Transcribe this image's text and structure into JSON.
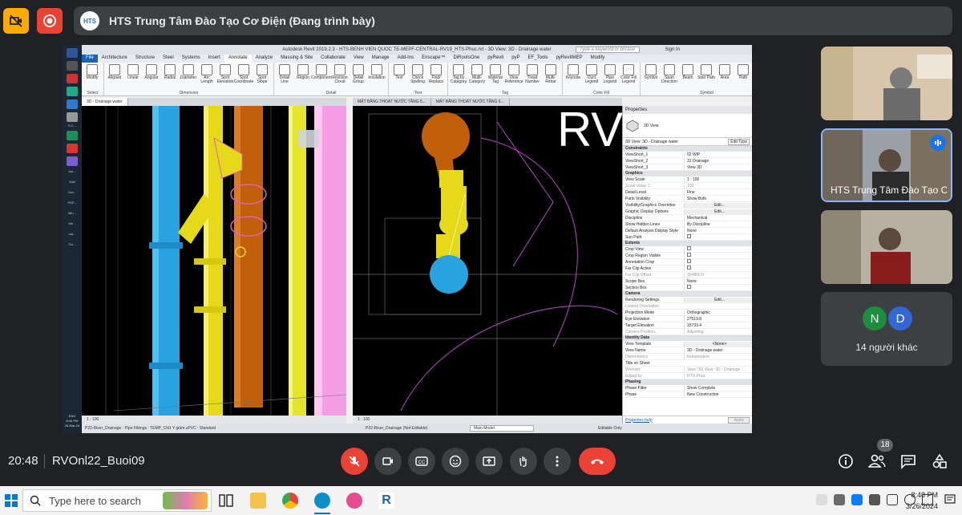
{
  "top": {
    "presenting_title": "HTS Trung Tâm Đào Tạo Cơ Điện (Đang trình bày)",
    "presenter_logo": "HTS"
  },
  "revit": {
    "title": "Autodesk Revit 2019.2.3 - HTS-BENH VIEN QUOC TE-MEPF-CENTRAL-RV19_HTS-Phuc.rvt - 3D View: 3D - Drainage water",
    "search_placeholder": "Type a keyword or phrase",
    "sign_in": "Sign In",
    "menu": [
      "File",
      "Architecture",
      "Structure",
      "Steel",
      "Systems",
      "Insert",
      "Annotate",
      "Analyze",
      "Massing & Site",
      "Collaborate",
      "View",
      "Manage",
      "Add-Ins",
      "Enscape™",
      "DiRootsOne",
      "pyRevit",
      "pyP",
      "EF_Tools",
      "pyRevitMEP",
      "Modify"
    ],
    "active_menu": "Annotate",
    "ribbon_groups": [
      {
        "label": "Select",
        "items": [
          "Modify"
        ]
      },
      {
        "label": "Dimension",
        "items": [
          "Aligned",
          "Linear",
          "Angular",
          "Radial",
          "Diameter",
          "Arc Length",
          "Spot Elevation",
          "Spot Coordinate",
          "Spot Slope"
        ]
      },
      {
        "label": "Detail",
        "items": [
          "Detail Line",
          "Region",
          "Component",
          "Revision Cloud",
          "Detail Group",
          "Insulation"
        ]
      },
      {
        "label": "Text",
        "items": [
          "Text",
          "Check Spelling",
          "Find/ Replace"
        ]
      },
      {
        "label": "Tag",
        "items": [
          "Tag by Category",
          "Multi-Category",
          "Material Tag",
          "View Reference",
          "Tread Number",
          "Multi- Rebar"
        ]
      },
      {
        "label": "Color Fill",
        "items": [
          "Keynote",
          "Duct Legend",
          "Pipe Legend",
          "Color Fill Legend"
        ]
      },
      {
        "label": "Symbol",
        "items": [
          "Symbol",
          "Span Direction",
          "Beam",
          "Stair Path",
          "Area",
          "Path",
          "Fabric"
        ]
      }
    ],
    "tabs": [
      "3D - Drainage water",
      "MẶT BẰNG THOÁT NƯỚC TẦNG 5...",
      "MẶT BẰNG THOÁT NƯỚC TẦNG 6..."
    ],
    "left_scale": "1 : 100",
    "right_scale": "1 : 100",
    "viewport_big_text": "RV",
    "status_left": "P22-Riser_Drainage : Pipe Fittings : TEMP_Chữ Y giảm uPVC : Standard",
    "status_mid": "P22-Riser_Drainage (Not Editable)",
    "status_model": "Main Model",
    "status_editable": "Editable Only",
    "properties": {
      "header": "Properties",
      "type": "3D View",
      "selector": "3D View: 3D - Drainage water",
      "edit_type": "Edit Type",
      "sections": [
        {
          "name": "Constraints",
          "rows": [
            [
              "ViewShort_1",
              "02 WIP"
            ],
            [
              "ViewShort_2",
              "31 Drainage"
            ],
            [
              "ViewShort_3",
              "View 3D"
            ]
          ]
        },
        {
          "name": "Graphics",
          "rows": [
            [
              "View Scale",
              "1 : 100"
            ],
            [
              "Scale Value 1:",
              "100"
            ],
            [
              "Detail Level",
              "Fine"
            ],
            [
              "Parts Visibility",
              "Show Both"
            ],
            [
              "Visibility/Graphics Overrides",
              "Edit..."
            ],
            [
              "Graphic Display Options",
              "Edit..."
            ],
            [
              "Discipline",
              "Mechanical"
            ],
            [
              "Show Hidden Lines",
              "By Discipline"
            ],
            [
              "Default Analysis Display Style",
              "None"
            ],
            [
              "Sun Path",
              ""
            ]
          ]
        },
        {
          "name": "Extents",
          "rows": [
            [
              "Crop View",
              ""
            ],
            [
              "Crop Region Visible",
              ""
            ],
            [
              "Annotation Crop",
              ""
            ],
            [
              "Far Clip Active",
              ""
            ],
            [
              "Far Clip Offset",
              "304800.0"
            ],
            [
              "Scope Box",
              "None"
            ],
            [
              "Section Box",
              ""
            ]
          ]
        },
        {
          "name": "Camera",
          "rows": [
            [
              "Rendering Settings",
              "Edit..."
            ],
            [
              "Locked Orientation",
              ""
            ],
            [
              "Projection Mode",
              "Orthographic"
            ],
            [
              "Eye Elevation",
              "27519.8"
            ],
            [
              "Target Elevation",
              "15733.4"
            ],
            [
              "Camera Position",
              "Adjusting"
            ]
          ]
        },
        {
          "name": "Identity Data",
          "rows": [
            [
              "View Template",
              "<None>"
            ],
            [
              "View Name",
              "3D - Drainage water"
            ],
            [
              "Dependency",
              "Independent"
            ],
            [
              "Title on Sheet",
              ""
            ],
            [
              "Workset",
              "View \"3D View: 3D - Drainage ..."
            ],
            [
              "Edited by",
              "HTS-Phuc"
            ]
          ]
        },
        {
          "name": "Phasing",
          "rows": [
            [
              "Phase Filter",
              "Show Complete"
            ],
            [
              "Phase",
              "New Construction"
            ]
          ]
        }
      ],
      "help": "Properties help",
      "apply": "Apply"
    }
  },
  "windows_side": {
    "items": [
      "S.C...",
      "Aut...",
      "Zalo",
      "Dra...",
      "PDF...",
      "iMo...",
      "Me...",
      "ma...",
      "Go..."
    ],
    "lang": "ENG",
    "time": "8:46 PM",
    "date": "26-Mar-24"
  },
  "participants": [
    {
      "name": ""
    },
    {
      "name": "HTS Trung Tâm Đào Tạo Cơ Điện"
    },
    {
      "name": ""
    }
  ],
  "others": {
    "initials": [
      "N",
      "D"
    ],
    "label": "14 người khác",
    "colors": [
      "#1e8e3e",
      "#3367d6"
    ]
  },
  "bottom": {
    "time": "20:48",
    "meeting": "RVOnl22_Buoi09",
    "participants_count": "18"
  },
  "taskbar": {
    "search_placeholder": "Type here to search",
    "time": "8:48 PM",
    "date": "3/26/2024"
  }
}
